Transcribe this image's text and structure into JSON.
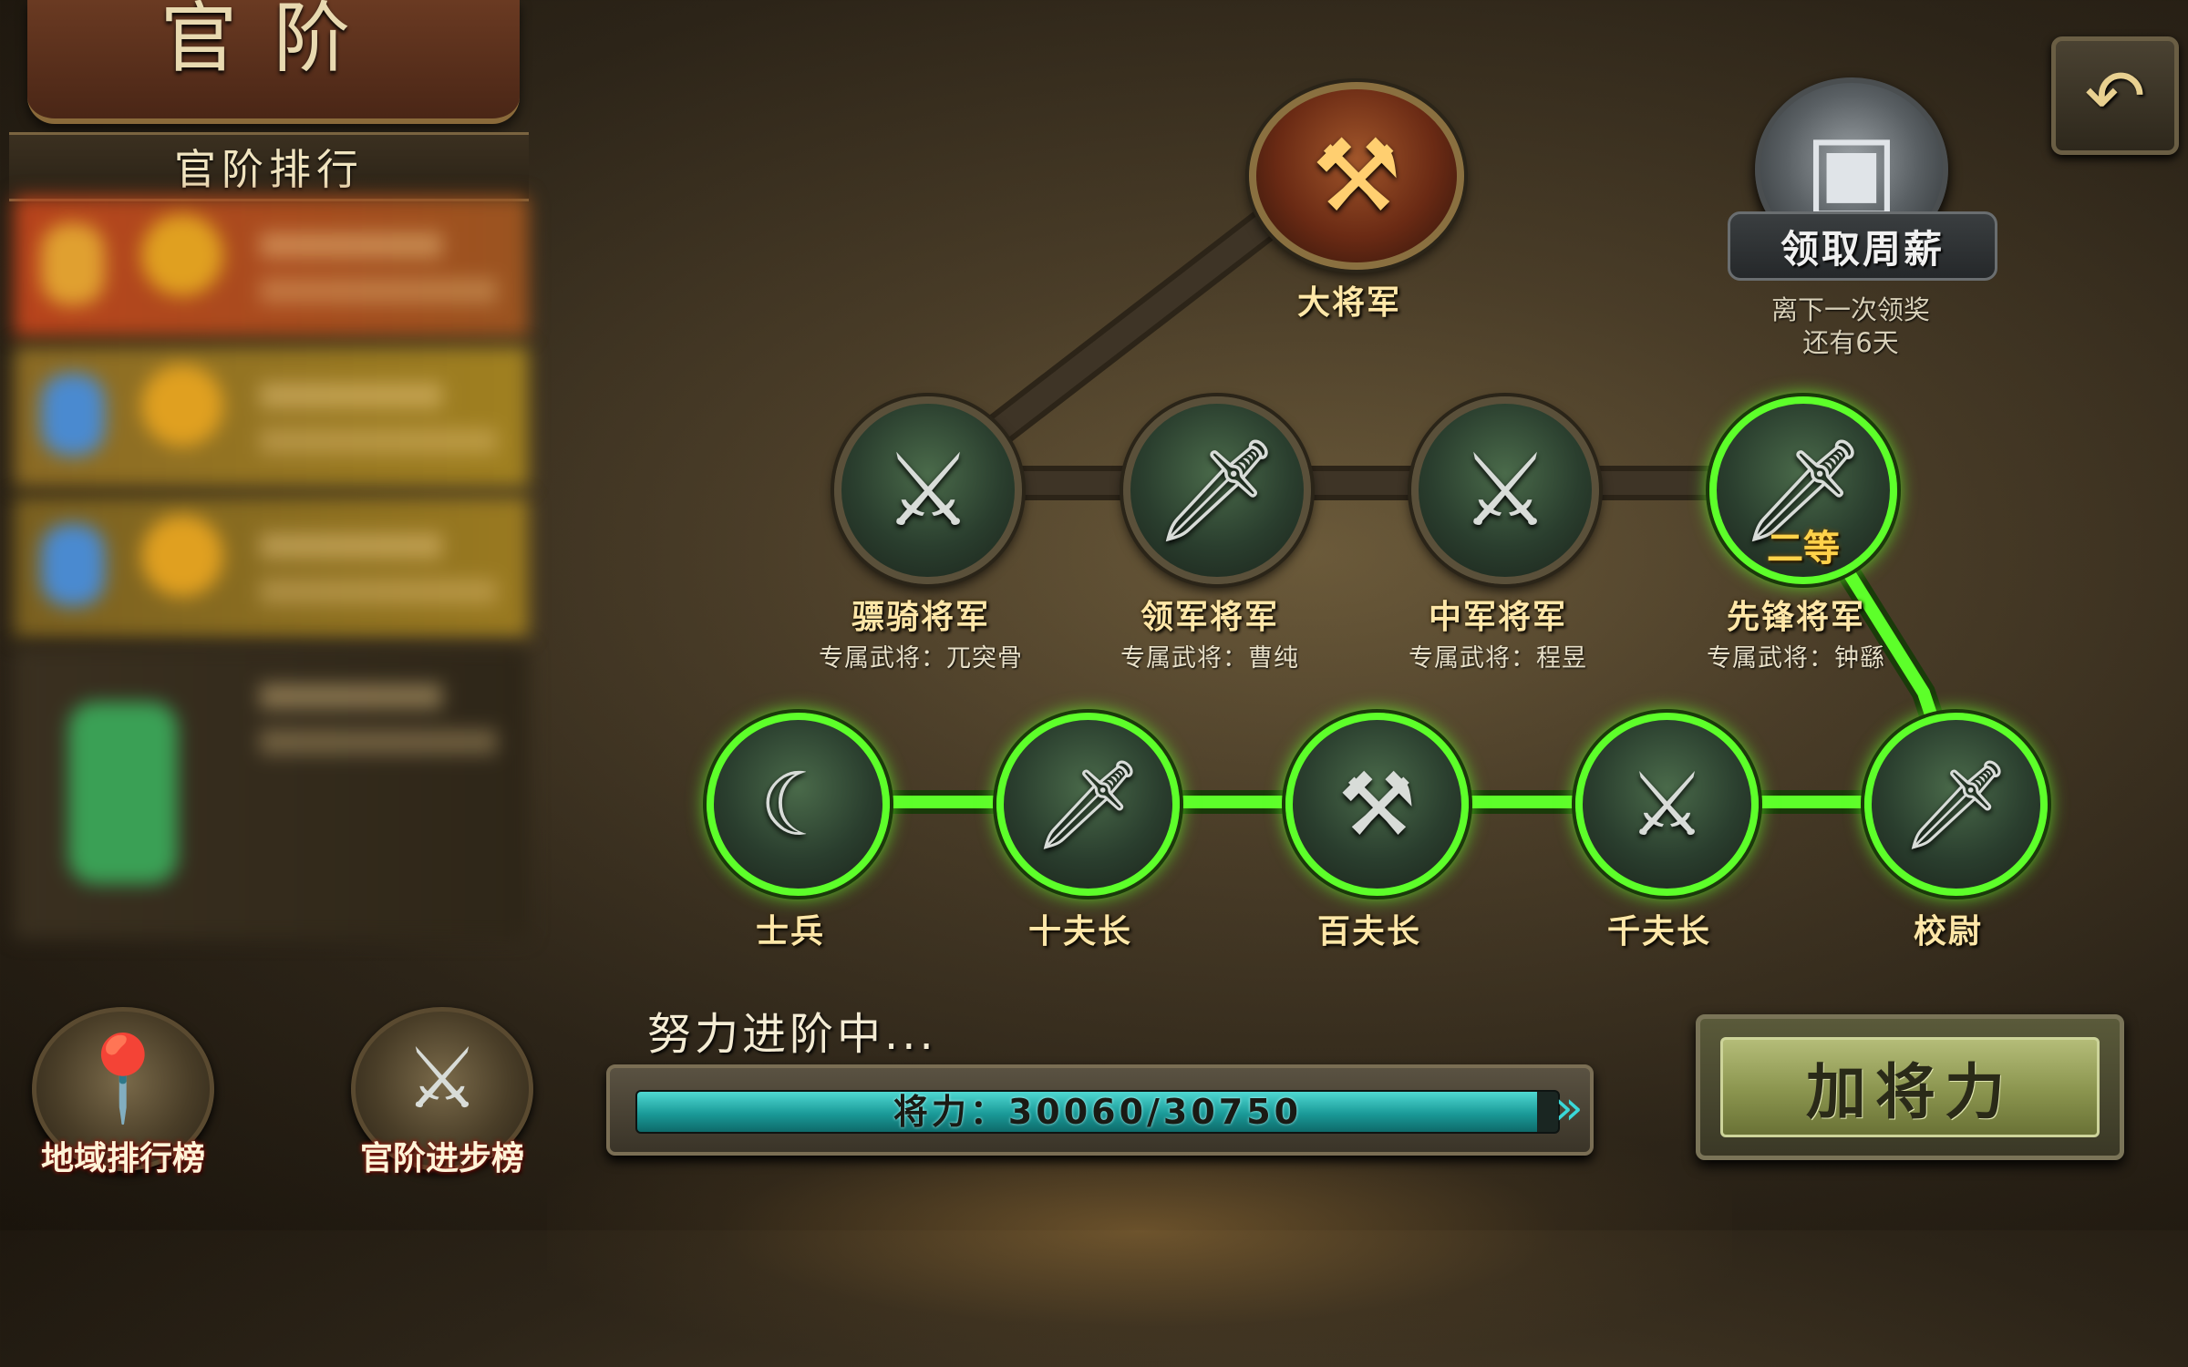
{
  "header": {
    "title": "官阶",
    "ranking_title": "官阶排行"
  },
  "sidebar": {
    "bottom_buttons": [
      {
        "label": "地域排行榜",
        "icon": "map-pin-icon"
      },
      {
        "label": "官阶进步榜",
        "icon": "crossed-swords-up-icon"
      }
    ]
  },
  "reward": {
    "button_label": "领取周薪",
    "note_line1": "离下一次领奖",
    "note_line2": "还有6天",
    "icon": "treasure-chest-icon"
  },
  "top_rank": {
    "name": "大将军",
    "icon": "war-axe-emblem-icon"
  },
  "generals": [
    {
      "name": "骠骑将军",
      "hero": "专属武将：兀突骨",
      "icon": "triple-swords-icon"
    },
    {
      "name": "领军将军",
      "hero": "专属武将：曹纯",
      "icon": "swords-rack-icon"
    },
    {
      "name": "中军将军",
      "hero": "专属武将：程昱",
      "icon": "crossed-swords-icon"
    },
    {
      "name": "先锋将军",
      "hero": "专属武将：钟繇",
      "icon": "single-sword-icon",
      "grade": "二等",
      "active": true
    }
  ],
  "soldiers": [
    {
      "name": "士兵",
      "icon": "sickle-icon"
    },
    {
      "name": "十夫长",
      "icon": "dagger-icon"
    },
    {
      "name": "百夫长",
      "icon": "halberd-icon"
    },
    {
      "name": "千夫长",
      "icon": "curved-blade-icon"
    },
    {
      "name": "校尉",
      "icon": "glaive-icon"
    }
  ],
  "progress": {
    "caption": "努力进阶中...",
    "label": "将力：30060/30750",
    "current": 30060,
    "max": 30750
  },
  "actions": {
    "add_power": "加将力",
    "back_icon": "back-arrow-icon"
  },
  "colors": {
    "active_path": "#5dff2a",
    "progress_fill": "#1a9a98",
    "label_gold": "#ffe7a8"
  }
}
